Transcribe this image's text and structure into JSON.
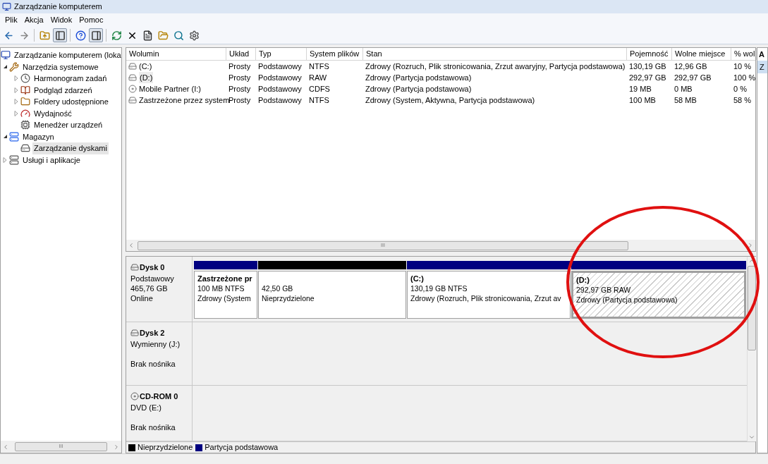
{
  "window": {
    "title": "Zarządzanie komputerem"
  },
  "menu": [
    "Plik",
    "Akcja",
    "Widok",
    "Pomoc"
  ],
  "toolbar": [
    {
      "kind": "back",
      "pressed": false
    },
    {
      "kind": "forward",
      "pressed": false
    },
    {
      "kind": "sep"
    },
    {
      "kind": "up",
      "pressed": false
    },
    {
      "kind": "tree",
      "pressed": true
    },
    {
      "kind": "sep"
    },
    {
      "kind": "help",
      "pressed": false
    },
    {
      "kind": "actions",
      "pressed": true
    },
    {
      "kind": "sep"
    },
    {
      "kind": "refresh",
      "pressed": false
    },
    {
      "kind": "delete",
      "pressed": false
    },
    {
      "kind": "properties",
      "pressed": false
    },
    {
      "kind": "open",
      "pressed": false
    },
    {
      "kind": "search",
      "pressed": false
    },
    {
      "kind": "settings",
      "pressed": false
    }
  ],
  "tree": [
    {
      "label": "Zarządzanie komputerem (loka",
      "kind": "computer",
      "selected": false,
      "children": [
        {
          "label": "Narzędzia systemowe",
          "kind": "tools",
          "expanded": true,
          "selected": false,
          "children": [
            {
              "label": "Harmonogram zadań",
              "kind": "clock",
              "expanded": false,
              "selected": false
            },
            {
              "label": "Podgląd zdarzeń",
              "kind": "log",
              "expanded": false,
              "selected": false
            },
            {
              "label": "Foldery udostępnione",
              "kind": "folder",
              "expanded": false,
              "selected": false
            },
            {
              "label": "Wydajność",
              "kind": "gauge",
              "expanded": false,
              "selected": false
            },
            {
              "label": "Menedżer urządzeń",
              "kind": "device",
              "selected": false
            }
          ]
        },
        {
          "label": "Magazyn",
          "kind": "storage",
          "expanded": true,
          "selected": false,
          "children": [
            {
              "label": "Zarządzanie dyskami",
              "kind": "disk",
              "selected": true
            }
          ]
        },
        {
          "label": "Usługi i aplikacje",
          "kind": "services",
          "expanded": false,
          "selected": false
        }
      ]
    }
  ],
  "table": {
    "columns": [
      "Wolumin",
      "Układ",
      "Typ",
      "System plików",
      "Stan",
      "Pojemność",
      "Wolne miejsce",
      "% wol"
    ],
    "rows": [
      {
        "kind": "hdd",
        "selected": false,
        "cells": [
          "(C:)",
          "Prosty",
          "Podstawowy",
          "NTFS",
          "Zdrowy (Rozruch, Plik stronicowania, Zrzut awaryjny, Partycja podstawowa)",
          "130,19 GB",
          "12,96 GB",
          "10 %"
        ]
      },
      {
        "kind": "hdd",
        "selected": true,
        "cells": [
          "(D:)",
          "Prosty",
          "Podstawowy",
          "RAW",
          "Zdrowy (Partycja podstawowa)",
          "292,97 GB",
          "292,97 GB",
          "100 %"
        ]
      },
      {
        "kind": "cd",
        "selected": false,
        "cells": [
          "Mobile Partner (I:)",
          "Prosty",
          "Podstawowy",
          "CDFS",
          "Zdrowy (Partycja podstawowa)",
          "19 MB",
          "0 MB",
          "0 %"
        ]
      },
      {
        "kind": "hdd",
        "selected": false,
        "cells": [
          "Zastrzeżone przez system",
          "Prosty",
          "Podstawowy",
          "NTFS",
          "Zdrowy (System, Aktywna, Partycja podstawowa)",
          "100 MB",
          "58 MB",
          "58 %"
        ]
      }
    ]
  },
  "scroll_marker": "III",
  "actions": {
    "title": "A",
    "items": [
      {
        "label": "Z",
        "selected": true
      }
    ]
  },
  "disks": [
    {
      "name": "Dysk 0",
      "kind": "hdd",
      "lines": [
        "Podstawowy",
        "465,76 GB"
      ],
      "status": "Online",
      "partitions": [
        {
          "kind": "primary",
          "selected": false,
          "title": "Zastrzeżone pr",
          "lines": [
            "100 MB NTFS",
            "Zdrowy (System"
          ]
        },
        {
          "kind": "unallocated",
          "selected": false,
          "lines": [
            "42,50 GB",
            "Nieprzydzielone"
          ]
        },
        {
          "kind": "primary",
          "selected": false,
          "title": "(C:)",
          "lines": [
            "130,19 GB NTFS",
            "Zdrowy (Rozruch, Plik stronicowania, Zrzut av"
          ]
        },
        {
          "kind": "primary",
          "selected": true,
          "title": "(D:)",
          "lines": [
            "292,97 GB RAW",
            "Zdrowy (Partycja podstawowa)"
          ]
        }
      ]
    },
    {
      "name": "Dysk 2",
      "kind": "removable",
      "lines": [
        "Wymienny (J:)"
      ],
      "status": "Brak nośnika"
    },
    {
      "name": "CD-ROM 0",
      "kind": "cdrom",
      "lines": [
        "DVD (E:)"
      ],
      "status": "Brak nośnika"
    }
  ],
  "legend": [
    {
      "label": "Nieprzydzielone",
      "color": "#000000"
    },
    {
      "label": "Partycja podstawowa",
      "color": "#000080"
    }
  ],
  "left_scroll_marker": "III",
  "annotation": {
    "kind": "ellipse"
  }
}
